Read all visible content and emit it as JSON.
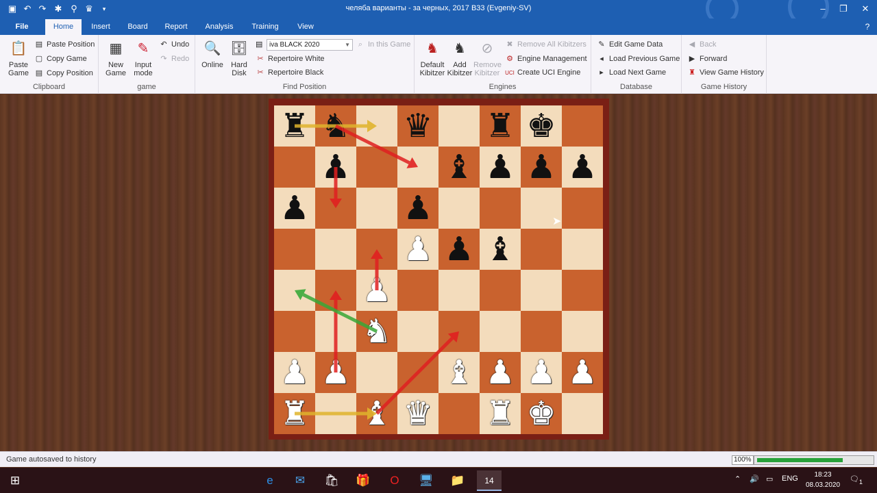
{
  "window": {
    "title": "челяба варианты - за черных,  2017  B33  (Evgeniy-SV)",
    "quick_access": [
      "save-icon",
      "undo-icon",
      "redo-icon",
      "bug-icon",
      "pin-icon",
      "hat-icon",
      "more-icon"
    ],
    "controls": {
      "minimize": "–",
      "restore": "❐",
      "close": "✕",
      "help": "?"
    }
  },
  "tabs": [
    "File",
    "Home",
    "Insert",
    "Board",
    "Report",
    "Analysis",
    "Training",
    "View"
  ],
  "active_tab": "Home",
  "ribbon": {
    "clipboard": {
      "label": "Clipboard",
      "paste_game": "Paste Game",
      "items": [
        "Paste Position",
        "Copy Game",
        "Copy Position"
      ]
    },
    "game": {
      "label": "game",
      "new_game": "New Game",
      "input_mode": "Input mode",
      "undo": "Undo",
      "redo": "Redo"
    },
    "find_position": {
      "label": "Find Position",
      "online": "Online",
      "hard_disk": "Hard Disk",
      "database_value": "iva BLACK 2020",
      "in_this_game": "In this Game",
      "repertoire_white": "Repertoire White",
      "repertoire_black": "Repertoire Black"
    },
    "engines": {
      "label": "Engines",
      "default_kibitzer": "Default Kibitzer",
      "add_kibitzer": "Add Kibitzer",
      "remove_kibitzer": "Remove Kibitzer",
      "remove_all": "Remove All Kibitzers",
      "engine_management": "Engine Management",
      "create_uci": "Create UCI Engine"
    },
    "database": {
      "label": "Database",
      "edit_game_data": "Edit Game Data",
      "load_previous": "Load Previous Game",
      "load_next": "Load Next Game"
    },
    "game_history": {
      "label": "Game History",
      "back": "Back",
      "forward": "Forward",
      "view_history": "View Game History"
    }
  },
  "board": {
    "orientation": "white-bottom",
    "pieces": [
      [
        "r",
        "n",
        "",
        "q",
        "",
        "r",
        "k",
        ""
      ],
      [
        "",
        "p",
        "",
        "",
        "b",
        "p",
        "p",
        "p"
      ],
      [
        "p",
        "",
        "",
        "p",
        "",
        "",
        "",
        ""
      ],
      [
        "",
        "",
        "",
        "P",
        "p",
        "b",
        "",
        ""
      ],
      [
        "",
        "",
        "P",
        "",
        "",
        "",
        "",
        ""
      ],
      [
        "",
        "",
        "N",
        "",
        "",
        "",
        "",
        ""
      ],
      [
        "P",
        "P",
        "",
        "",
        "B",
        "P",
        "P",
        "P"
      ],
      [
        "R",
        "",
        "B",
        "Q",
        "",
        "R",
        "K",
        ""
      ]
    ],
    "arrows": [
      {
        "from": "a8",
        "to": "c8",
        "color": "#e0b42c"
      },
      {
        "from": "b8",
        "to": "d7",
        "color": "#e02020"
      },
      {
        "from": "b7",
        "to": "b6",
        "color": "#e02020"
      },
      {
        "from": "c4",
        "to": "c5",
        "color": "#e02020"
      },
      {
        "from": "b2",
        "to": "b4",
        "color": "#e02020"
      },
      {
        "from": "c3",
        "to": "a4",
        "color": "#38a838"
      },
      {
        "from": "a1",
        "to": "c1",
        "color": "#e0b42c"
      },
      {
        "from": "c1",
        "to": "e3",
        "color": "#e02020"
      }
    ],
    "light_color": "#f3dcbc",
    "dark_color": "#c9622e"
  },
  "status": {
    "message": "Game autosaved to history",
    "zoom": "100%",
    "progress": 0.95
  },
  "taskbar": {
    "apps": [
      "edge-icon",
      "mail-icon",
      "store-icon",
      "gift-icon",
      "opera-icon",
      "computer-icon",
      "folder-icon",
      "chessbase-icon"
    ],
    "language": "ENG",
    "time": "18:23",
    "date": "08.03.2020",
    "notifications": "1",
    "chessbase_label": "14"
  }
}
